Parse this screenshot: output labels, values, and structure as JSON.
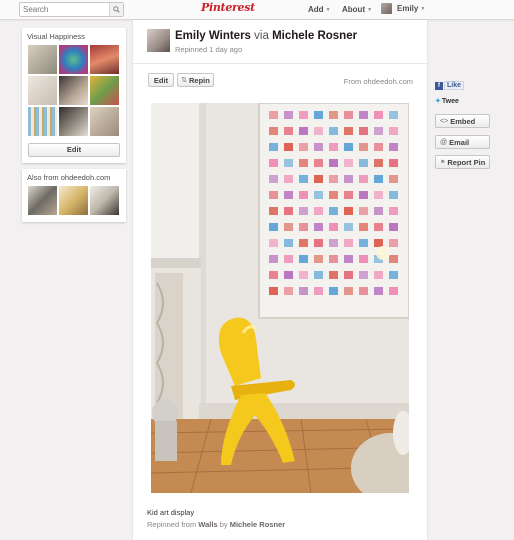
{
  "header": {
    "search_placeholder": "Search",
    "logo": "Pinterest",
    "nav": {
      "add": "Add",
      "about": "About",
      "user": "Emily"
    }
  },
  "board_card": {
    "title": "Visual Happiness",
    "edit_label": "Edit"
  },
  "also_card": {
    "title": "Also from ohdeedoh.com"
  },
  "pin": {
    "user": "Emily Winters",
    "via": "via",
    "via_user": "Michele Rosner",
    "subtitle": "Repinned 1 day ago",
    "edit_label": "Edit",
    "repin_label": "Repin",
    "from_text": "From ohdeedoh.com",
    "caption": "Kid art display",
    "repinned_prefix": "Repinned from",
    "repinned_board": "Walls",
    "repinned_by": "by",
    "repinned_user": "Michele Rosner"
  },
  "sidebar_actions": {
    "like": "Like",
    "tweet": "Twee",
    "embed": "Embed",
    "email": "Email",
    "report": "Report Pin"
  },
  "colors": {
    "brand": "#c8232c",
    "chair": "#f4c81c",
    "floor": "#c58a52",
    "wall": "#ece9e4"
  }
}
